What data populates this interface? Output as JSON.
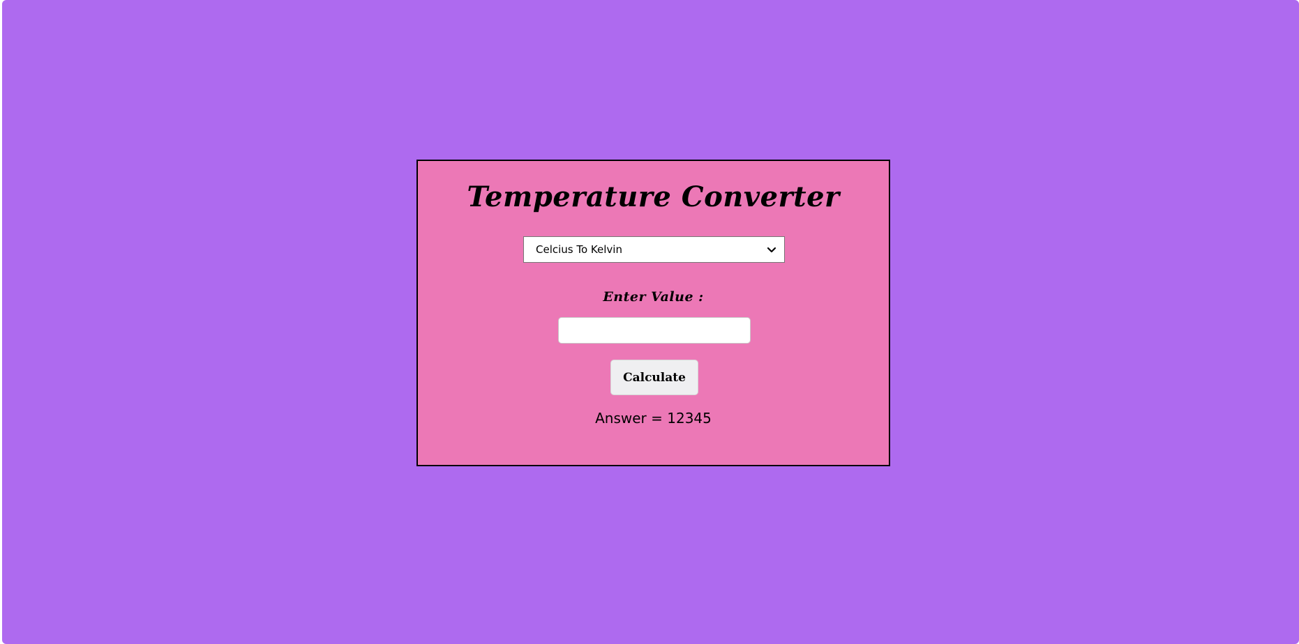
{
  "app": {
    "title": "Temperature Converter"
  },
  "converter": {
    "select": {
      "selected": "Celcius To Kelvin"
    },
    "value_label": "Enter Value :",
    "input": {
      "value": "",
      "placeholder": ""
    },
    "calculate_label": "Calculate",
    "answer_text": "Answer = 12345"
  },
  "colors": {
    "background": "#ae6aef",
    "card": "#ec78b6",
    "card_border": "#000000",
    "button": "#efeff1"
  },
  "icons": {
    "dropdown": "chevron-down-icon"
  }
}
